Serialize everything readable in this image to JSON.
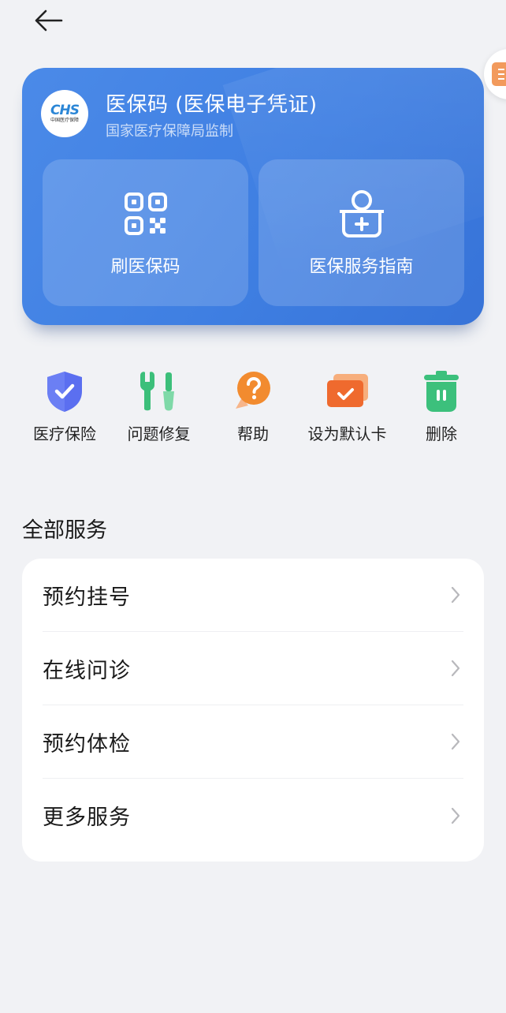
{
  "card": {
    "title": "医保码 (医保电子凭证)",
    "subtitle": "国家医疗保障局监制",
    "logo_mark": "CHS",
    "logo_sub": "中国医疗保障",
    "tiles": [
      {
        "label": "刷医保码",
        "icon": "qr-code-icon"
      },
      {
        "label": "医保服务指南",
        "icon": "medical-kit-icon"
      }
    ],
    "color_primary": "#4285e6"
  },
  "actions": [
    {
      "label": "医疗保险",
      "icon": "shield-check-icon",
      "color": "#5b6ff0"
    },
    {
      "label": "问题修复",
      "icon": "repair-tools-icon",
      "color": "#3cbf7a"
    },
    {
      "label": "帮助",
      "icon": "help-icon",
      "color": "#f28b2f"
    },
    {
      "label": "设为默认卡",
      "icon": "default-card-icon",
      "color": "#ef6a2e"
    },
    {
      "label": "删除",
      "icon": "trash-icon",
      "color": "#3cc07c"
    }
  ],
  "services": {
    "title": "全部服务",
    "items": [
      {
        "label": "预约挂号"
      },
      {
        "label": "在线问诊"
      },
      {
        "label": "预约体检"
      },
      {
        "label": "更多服务"
      }
    ]
  }
}
